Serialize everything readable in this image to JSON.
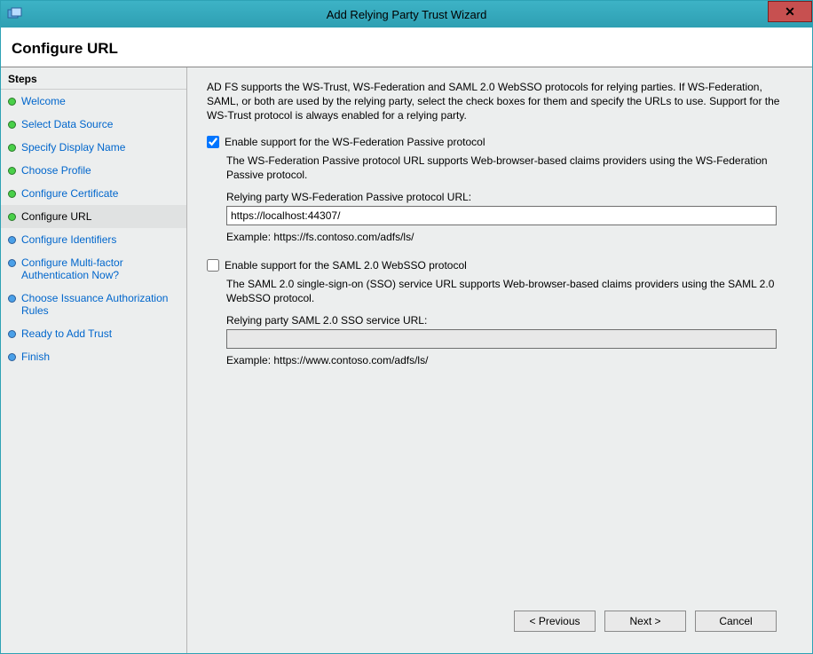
{
  "window": {
    "title": "Add Relying Party Trust Wizard"
  },
  "header": {
    "title": "Configure URL"
  },
  "sidebar": {
    "title": "Steps",
    "items": [
      {
        "label": "Welcome",
        "state": "done"
      },
      {
        "label": "Select Data Source",
        "state": "done"
      },
      {
        "label": "Specify Display Name",
        "state": "done"
      },
      {
        "label": "Choose Profile",
        "state": "done"
      },
      {
        "label": "Configure Certificate",
        "state": "done"
      },
      {
        "label": "Configure URL",
        "state": "current"
      },
      {
        "label": "Configure Identifiers",
        "state": "pending"
      },
      {
        "label": "Configure Multi-factor Authentication Now?",
        "state": "pending"
      },
      {
        "label": "Choose Issuance Authorization Rules",
        "state": "pending"
      },
      {
        "label": "Ready to Add Trust",
        "state": "pending"
      },
      {
        "label": "Finish",
        "state": "pending"
      }
    ]
  },
  "content": {
    "intro": "AD FS supports the WS-Trust, WS-Federation and SAML 2.0 WebSSO protocols for relying parties.  If WS-Federation, SAML, or both are used by the relying party, select the check boxes for them and specify the URLs to use.  Support for the WS-Trust protocol is always enabled for a relying party.",
    "wsfed": {
      "checkbox_label": "Enable support for the WS-Federation Passive protocol",
      "checked": true,
      "desc": "The WS-Federation Passive protocol URL supports Web-browser-based claims providers using the WS-Federation Passive protocol.",
      "url_label": "Relying party WS-Federation Passive protocol URL:",
      "url_value": "https://localhost:44307/",
      "example": "Example: https://fs.contoso.com/adfs/ls/"
    },
    "saml": {
      "checkbox_label": "Enable support for the SAML 2.0 WebSSO protocol",
      "checked": false,
      "desc": "The SAML 2.0 single-sign-on (SSO) service URL supports Web-browser-based claims providers using the SAML 2.0 WebSSO protocol.",
      "url_label": "Relying party SAML 2.0 SSO service URL:",
      "url_value": "",
      "example": "Example: https://www.contoso.com/adfs/ls/"
    }
  },
  "footer": {
    "previous": "< Previous",
    "next": "Next >",
    "cancel": "Cancel"
  }
}
